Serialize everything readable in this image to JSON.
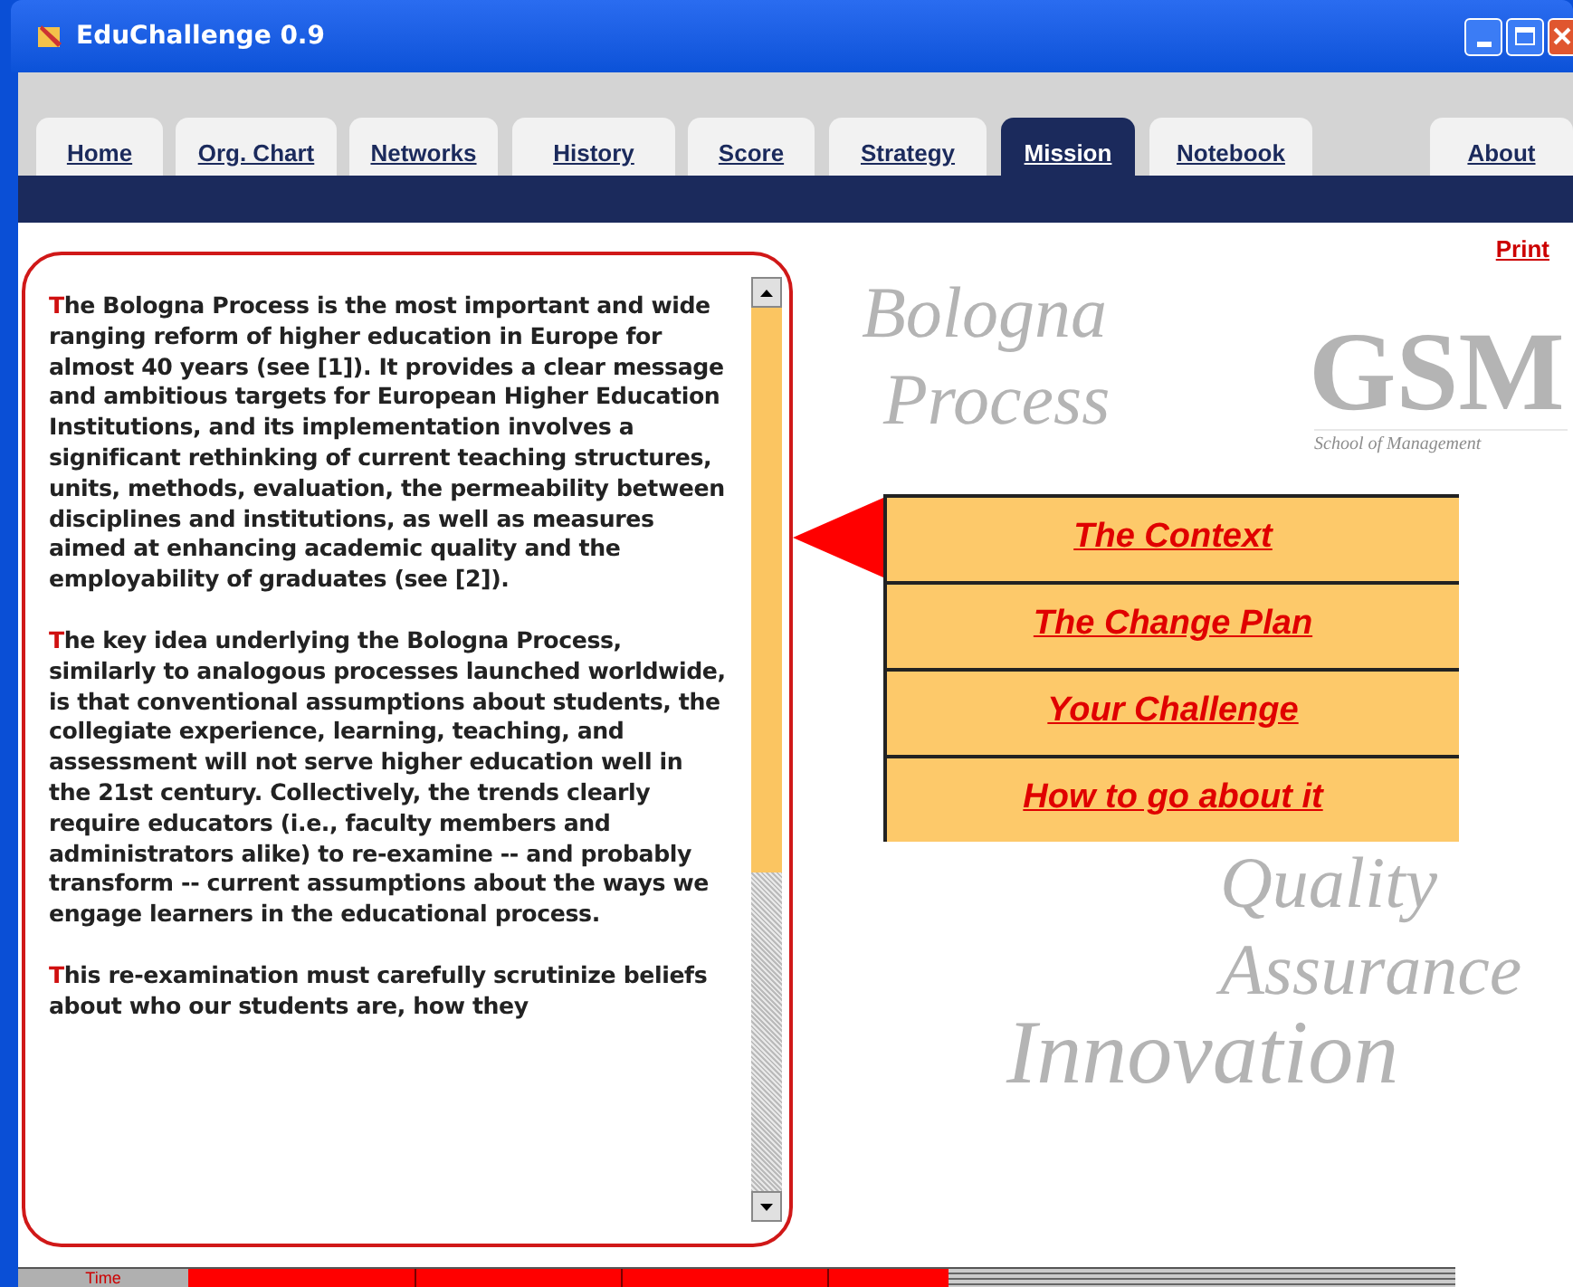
{
  "window": {
    "title": "EduChallenge 0.9"
  },
  "tabs": [
    {
      "label": "Home",
      "selected": false
    },
    {
      "label": "Org. Chart",
      "selected": false
    },
    {
      "label": "Networks",
      "selected": false
    },
    {
      "label": "History",
      "selected": false
    },
    {
      "label": "Score",
      "selected": false
    },
    {
      "label": "Strategy",
      "selected": false
    },
    {
      "label": "Mission",
      "selected": true
    },
    {
      "label": "Notebook",
      "selected": false
    },
    {
      "label": "About",
      "selected": false
    }
  ],
  "print_link": "Print",
  "paragraphs": [
    "The Bologna Process is the most important and wide ranging reform of higher education in Europe for almost 40 years (see [1]). It provides a clear message and ambitious targets for European Higher Education Institutions, and its implementation involves a significant rethinking of current teaching structures, units, methods, evaluation, the permeability between disciplines and institutions, as well as measures aimed at enhancing academic quality and the employability of graduates (see [2]).",
    "The key idea underlying the Bologna Process, similarly to analogous processes launched worldwide, is that conventional assumptions about students, the collegiate experience, learning, teaching, and assessment will not serve higher education well in the 21st century. Collectively, the trends clearly require educators (i.e., faculty members and administrators alike) to re-examine -- and probably transform -- current assumptions about the ways we engage learners in the educational process.",
    "This re-examination must carefully scrutinize beliefs about who our students are, how they"
  ],
  "background_words": {
    "bologna": "Bologna",
    "process": "Process",
    "gsm": "GSM",
    "gsm_sub": "School of Management",
    "quality": "Quality",
    "assurance": "Assurance",
    "innovation": "Innovation"
  },
  "menu": [
    {
      "label": "The Context",
      "selected": true
    },
    {
      "label": "The Change Plan",
      "selected": false
    },
    {
      "label": "Your Challenge",
      "selected": false
    },
    {
      "label": "How to go about it",
      "selected": false
    }
  ],
  "status_bar": {
    "label": "Time"
  }
}
